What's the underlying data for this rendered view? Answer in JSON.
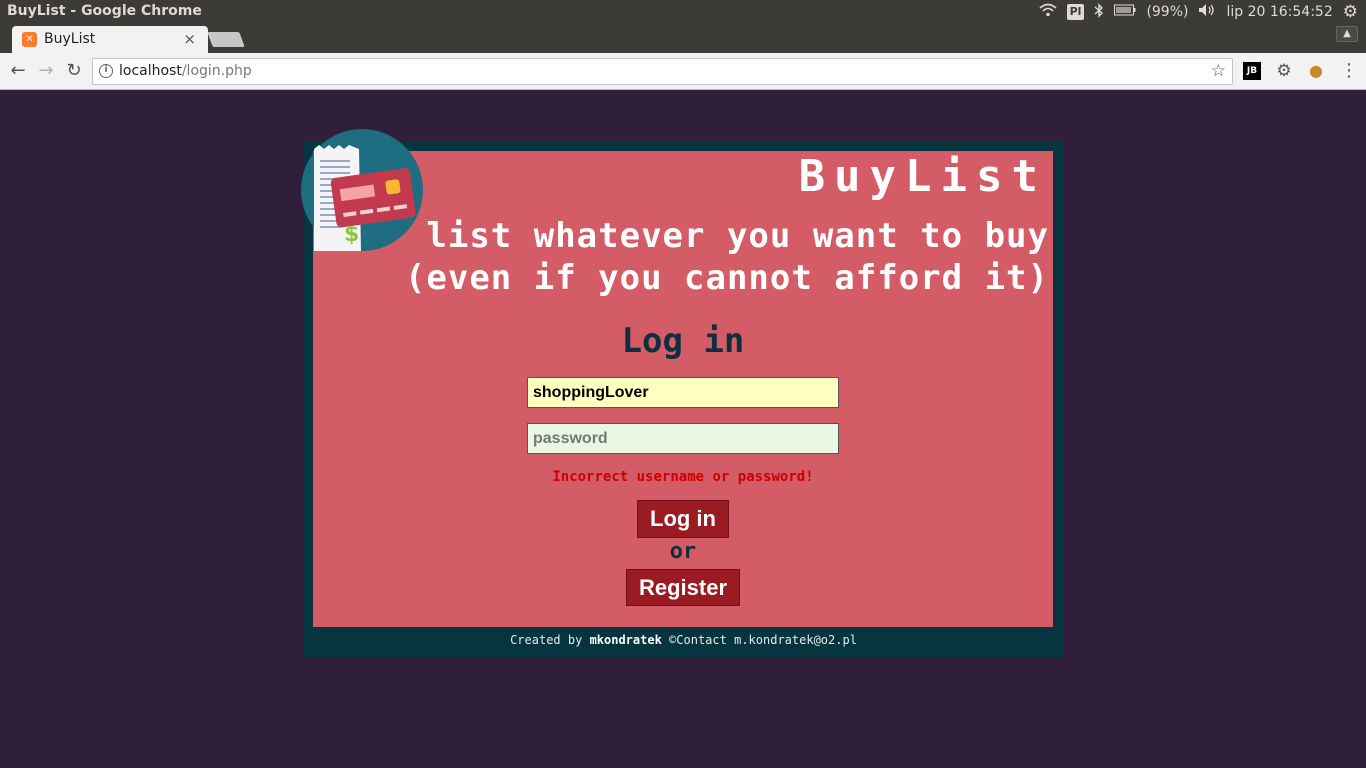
{
  "os_panel": {
    "window_title": "BuyList - Google Chrome",
    "keyboard_layout": "Pl",
    "battery": "(99%)",
    "clock": "lip 20 16:54:52"
  },
  "browser": {
    "tab_title": "BuyList",
    "url_host": "localhost",
    "url_path": "/login.php"
  },
  "app": {
    "brand": "BuyList",
    "tagline_line1": "list whatever you want to buy",
    "tagline_line2": "(even if you cannot afford it)",
    "form_title": "Log in",
    "username_value": "shoppingLover",
    "password_placeholder": "password",
    "error_message": "Incorrect username or password!",
    "login_button": "Log in",
    "or_text": "or",
    "register_button": "Register"
  },
  "footer": {
    "created_by": "Created by",
    "author": "mkondratek",
    "copyright": "©",
    "contact_label": "Contact",
    "contact_email": "m.kondratek@o2.pl"
  },
  "colors": {
    "page_bg": "#2f1f3b",
    "frame": "#06353f",
    "card": "#d45c66",
    "button": "#9b1b22",
    "error": "#cc0000"
  }
}
